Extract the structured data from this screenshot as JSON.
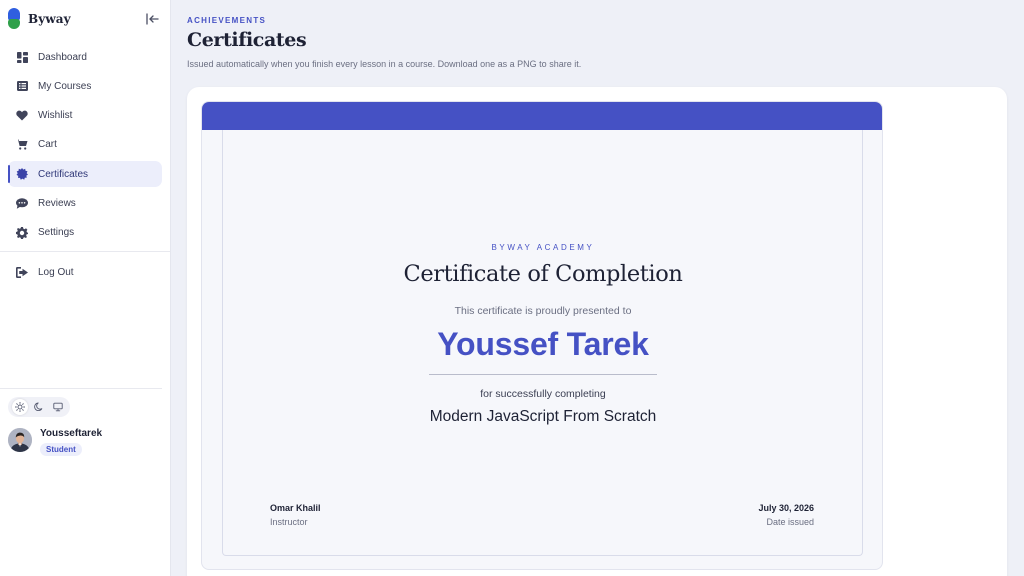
{
  "brand": {
    "name": "Byway"
  },
  "sidebar": {
    "items": [
      {
        "label": "Dashboard",
        "icon": "dashboard-icon"
      },
      {
        "label": "My Courses",
        "icon": "list-icon"
      },
      {
        "label": "Wishlist",
        "icon": "heart-icon"
      },
      {
        "label": "Cart",
        "icon": "cart-icon"
      },
      {
        "label": "Certificates",
        "icon": "badge-icon",
        "active": true
      },
      {
        "label": "Reviews",
        "icon": "chat-icon"
      },
      {
        "label": "Settings",
        "icon": "gear-icon"
      }
    ],
    "logout": {
      "label": "Log Out",
      "icon": "logout-icon"
    },
    "theme": {
      "options": [
        "light",
        "dark",
        "system"
      ],
      "selected": "light"
    },
    "user": {
      "name": "Yousseftarek",
      "role": "Student"
    }
  },
  "page": {
    "eyebrow": "ACHIEVEMENTS",
    "title": "Certificates",
    "subtitle": "Issued automatically when you finish every lesson in a course. Download one as a PNG to share it."
  },
  "certificate": {
    "academy": "BYWAY ACADEMY",
    "title": "Certificate of Completion",
    "presented": "This certificate is proudly presented to",
    "recipient": "Youssef Tarek",
    "completing": "for successfully completing",
    "course": "Modern JavaScript From Scratch",
    "instructor_name": "Omar Khalil",
    "instructor_label": "Instructor",
    "date": "July 30, 2026",
    "date_label": "Date issued"
  },
  "colors": {
    "accent": "#4551c4",
    "logo_blue": "#2f5fe0",
    "logo_green": "#2fa04a",
    "background": "#eef0f7"
  }
}
